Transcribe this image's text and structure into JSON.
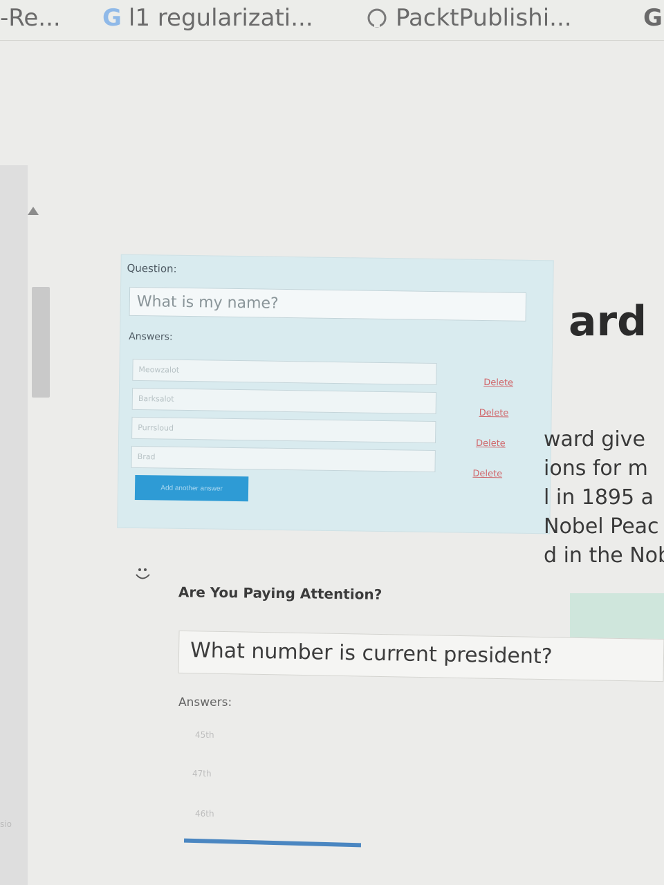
{
  "bookmarks": [
    {
      "label": "-Re...",
      "icon": "dash-icon"
    },
    {
      "label": "l1 regularizati...",
      "icon_text": "G",
      "icon": "google-icon"
    },
    {
      "label": "PacktPublishi...",
      "icon": "github-icon"
    },
    {
      "label": "",
      "icon_text": "G",
      "icon": "google-icon"
    }
  ],
  "editor": {
    "question_label": "Question:",
    "question_value": "What is my name?",
    "answers_label": "Answers:",
    "answers": [
      "Meowzalot",
      "Barksalot",
      "Purrsloud",
      "Brad"
    ],
    "delete_label": "Delete",
    "add_answer_label": "Add another answer",
    "colors": {
      "card_bg": "#d9ebef",
      "delete_link": "#d0676b",
      "add_button": "#2e9bd5"
    }
  },
  "background_text": {
    "heading_fragment": "ard",
    "lines": [
      "ward give",
      "ions for m",
      "l in 1895 a",
      "Nobel Peac",
      "d in the Nob"
    ]
  },
  "quiz": {
    "title": "Are You Paying Attention?",
    "question": "What number is current president?",
    "answers_label": "Answers:",
    "answers": [
      "45th",
      "47th",
      "46th"
    ]
  },
  "sidebar_text": "sio"
}
